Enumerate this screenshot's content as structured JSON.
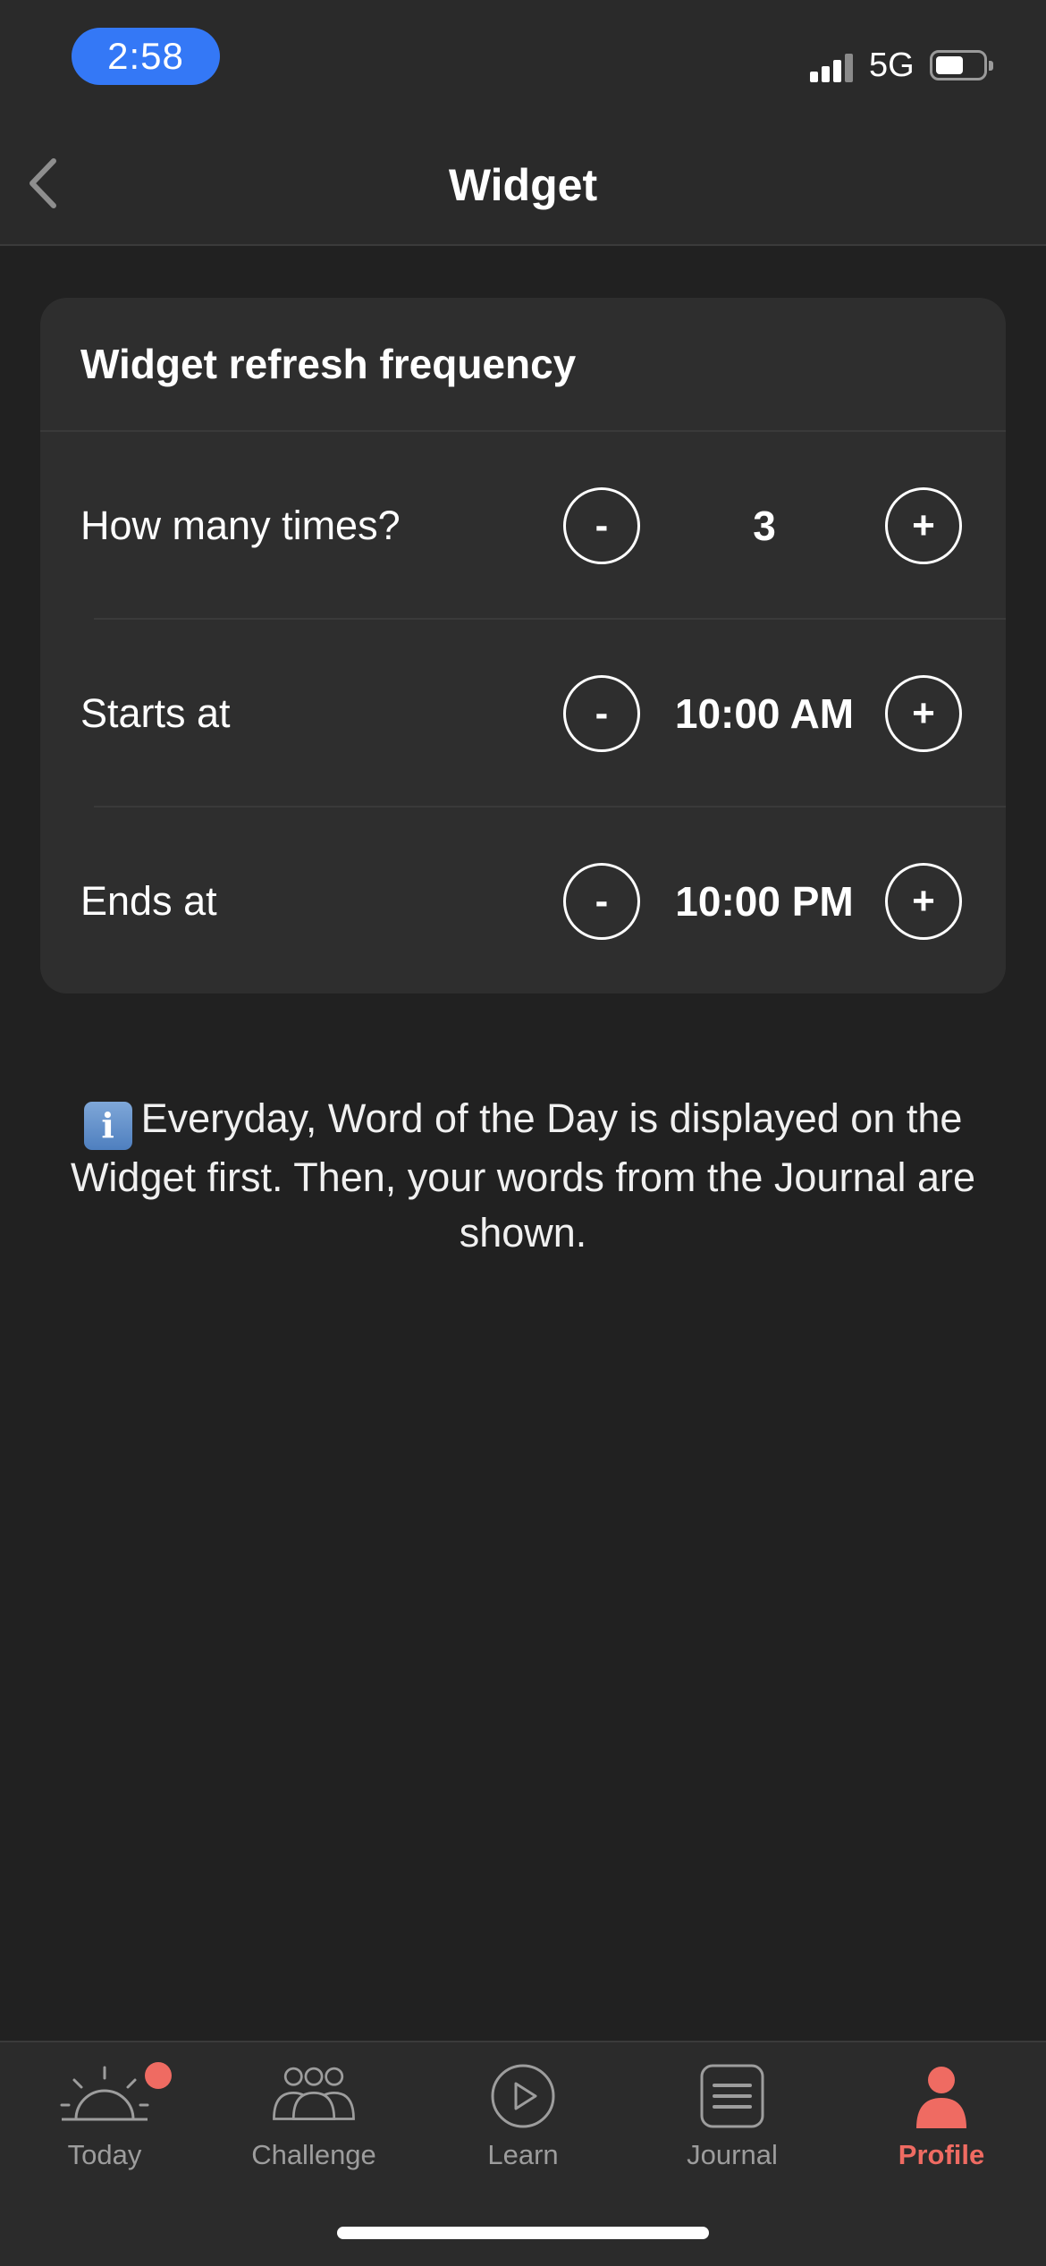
{
  "status_bar": {
    "time": "2:58",
    "network": "5G"
  },
  "nav": {
    "title": "Widget",
    "back_icon": "chevron-left-icon"
  },
  "card": {
    "header": "Widget refresh frequency",
    "rows": [
      {
        "label": "How many times?",
        "value": "3",
        "minus": "-",
        "plus": "+"
      },
      {
        "label": "Starts at",
        "value": "10:00 AM",
        "minus": "-",
        "plus": "+"
      },
      {
        "label": "Ends at",
        "value": "10:00 PM",
        "minus": "-",
        "plus": "+"
      }
    ]
  },
  "info": {
    "icon": "i",
    "text": "Everyday, Word of the Day is displayed on the Widget first. Then, your words from the Journal are shown."
  },
  "tabs": [
    {
      "label": "Today",
      "icon": "sunrise-icon",
      "badge": true
    },
    {
      "label": "Challenge",
      "icon": "group-icon"
    },
    {
      "label": "Learn",
      "icon": "play-circle-icon"
    },
    {
      "label": "Journal",
      "icon": "journal-icon"
    },
    {
      "label": "Profile",
      "icon": "person-icon",
      "active": true
    }
  ],
  "colors": {
    "accent": "#ef6b62",
    "time_pill": "#3478f6",
    "background": "#212121",
    "card": "#2e2e2e"
  }
}
